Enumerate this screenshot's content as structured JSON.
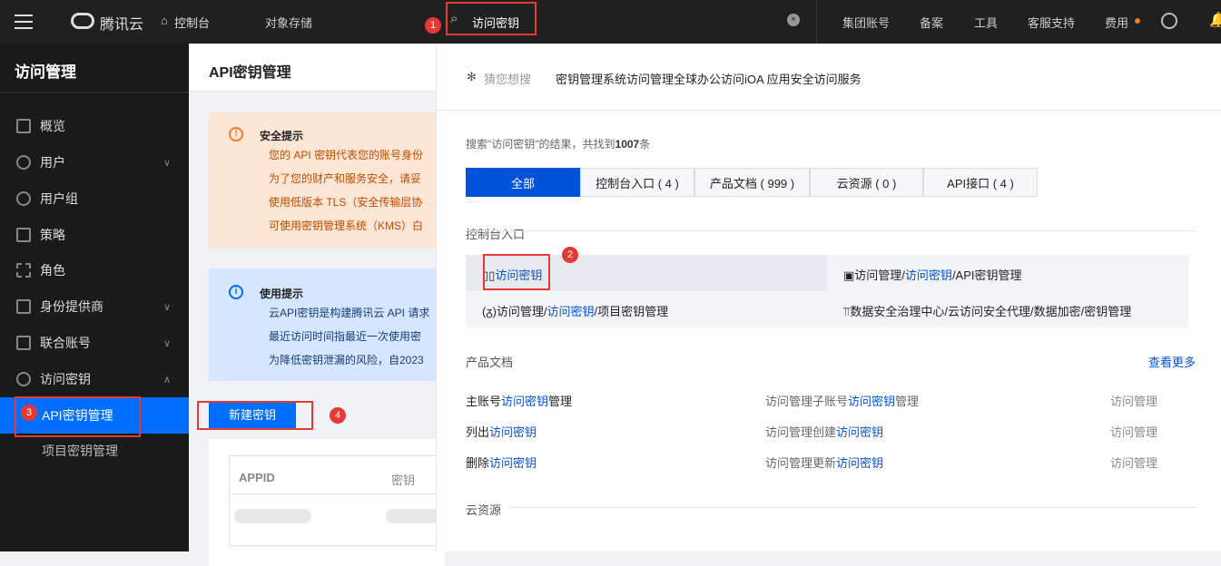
{
  "topbar": {
    "brand": "腾讯云",
    "console": "控制台",
    "service": "对象存储",
    "search_value": "访问密钥",
    "nav": [
      "集团账号",
      "备案",
      "工具",
      "客服支持",
      "费用"
    ]
  },
  "sidebar": {
    "title": "访问管理",
    "items": [
      {
        "label": "概览"
      },
      {
        "label": "用户"
      },
      {
        "label": "用户组"
      },
      {
        "label": "策略"
      },
      {
        "label": "角色"
      },
      {
        "label": "身份提供商"
      },
      {
        "label": "联合账号"
      },
      {
        "label": "访问密钥"
      }
    ],
    "sub": [
      "API密钥管理",
      "项目密钥管理"
    ]
  },
  "main": {
    "title": "API密钥管理",
    "warn": {
      "title": "安全提示",
      "lines": [
        "您的 API 密钥代表您的账号身份",
        "为了您的财产和服务安全，请妥",
        "使用低版本 TLS（安全传输层协",
        "可使用密钥管理系统（KMS）白"
      ]
    },
    "info": {
      "title": "使用提示",
      "lines": [
        "云API密钥是构建腾讯云 API 请求",
        "最近访问时间指最近一次使用密",
        "为降低密钥泄漏的风险，自2023"
      ]
    },
    "new_key": "新建密钥",
    "cols": [
      "APPID",
      "密钥"
    ]
  },
  "panel": {
    "guess_label": "猜您想搜",
    "guess": "密钥管理系统访问管理全球办公访问iOA 应用安全访问服务",
    "result_prefix": "搜索\"访问密钥\"的结果，共找到",
    "result_count": "1007",
    "result_suffix": "条",
    "tabs": [
      "全部",
      "控制台入口 ( 4 )",
      "产品文档 ( 999 )",
      "云资源 ( 0 )",
      "API接口 ( 4 )"
    ],
    "console_title": "控制台入口",
    "console": [
      [
        "",
        "访问密钥",
        ""
      ],
      [
        "访问管理/",
        "访问密钥",
        "/API密钥管理"
      ],
      [
        "访问管理/",
        "访问密钥",
        "/项目密钥管理"
      ],
      [
        "数据安全治理中心/云访问安全代理/数据加密/密钥管理",
        "",
        ""
      ]
    ],
    "docs_title": "产品文档",
    "more": "查看更多",
    "docs": [
      [
        [
          "主账号",
          "访问密钥",
          "管理"
        ],
        [
          "访问管理子账号",
          "访问密钥",
          "管理"
        ],
        "访问管理"
      ],
      [
        [
          "列出",
          "访问密钥",
          ""
        ],
        [
          "访问管理创建",
          "访问密钥",
          ""
        ],
        "访问管理"
      ],
      [
        [
          "删除",
          "访问密钥",
          ""
        ],
        [
          "访问管理更新",
          "访问密钥",
          ""
        ],
        "访问管理"
      ]
    ],
    "cloud_title": "云资源"
  },
  "annotations": [
    "1",
    "2",
    "3",
    "4"
  ]
}
